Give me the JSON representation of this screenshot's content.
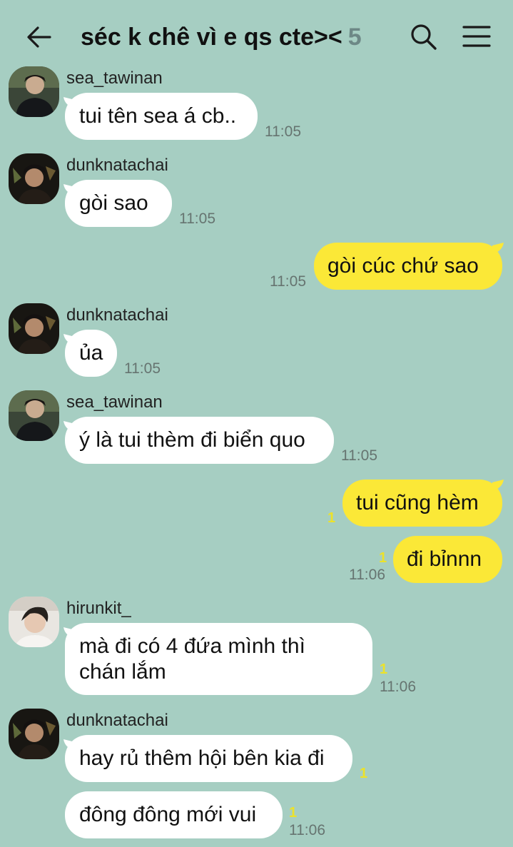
{
  "header": {
    "title": "séc k chê vì e qs cte><",
    "member_count": "5",
    "icons": [
      "back-arrow-icon",
      "search-icon",
      "menu-icon"
    ]
  },
  "messages": [
    {
      "sender": "sea_tawinan",
      "text": "tui tên sea á cb..",
      "time": "11:05"
    },
    {
      "sender": "dunknatachai",
      "text": "gòi sao",
      "time": "11:05"
    },
    {
      "sender": "me",
      "text": "gòi cúc chứ sao",
      "time": "11:05"
    },
    {
      "sender": "dunknatachai",
      "text": "ủa",
      "time": "11:05"
    },
    {
      "sender": "sea_tawinan",
      "text": "ý là tui thèm đi biển quo",
      "time": "11:05"
    },
    {
      "sender": "me",
      "text": "tui cũng hèm",
      "unread": "1"
    },
    {
      "sender": "me",
      "text": "đi bỉnnn",
      "unread": "1",
      "time": "11:06"
    },
    {
      "sender": "hirunkit_",
      "text_line1": "mà đi có 4 đứa mình thì",
      "text_line2": "chán lắm",
      "unread": "1",
      "time": "11:06"
    },
    {
      "sender": "dunknatachai",
      "text": "hay rủ thêm hội bên kia đi",
      "unread": "1"
    },
    {
      "sender": "dunknatachai",
      "text": "đông đông mới vui",
      "unread": "1",
      "time": "11:06"
    }
  ],
  "colors": {
    "background": "#a6cec2",
    "incoming_bubble": "#ffffff",
    "outgoing_bubble": "#fbe837",
    "unread_count": "#ece22a"
  }
}
